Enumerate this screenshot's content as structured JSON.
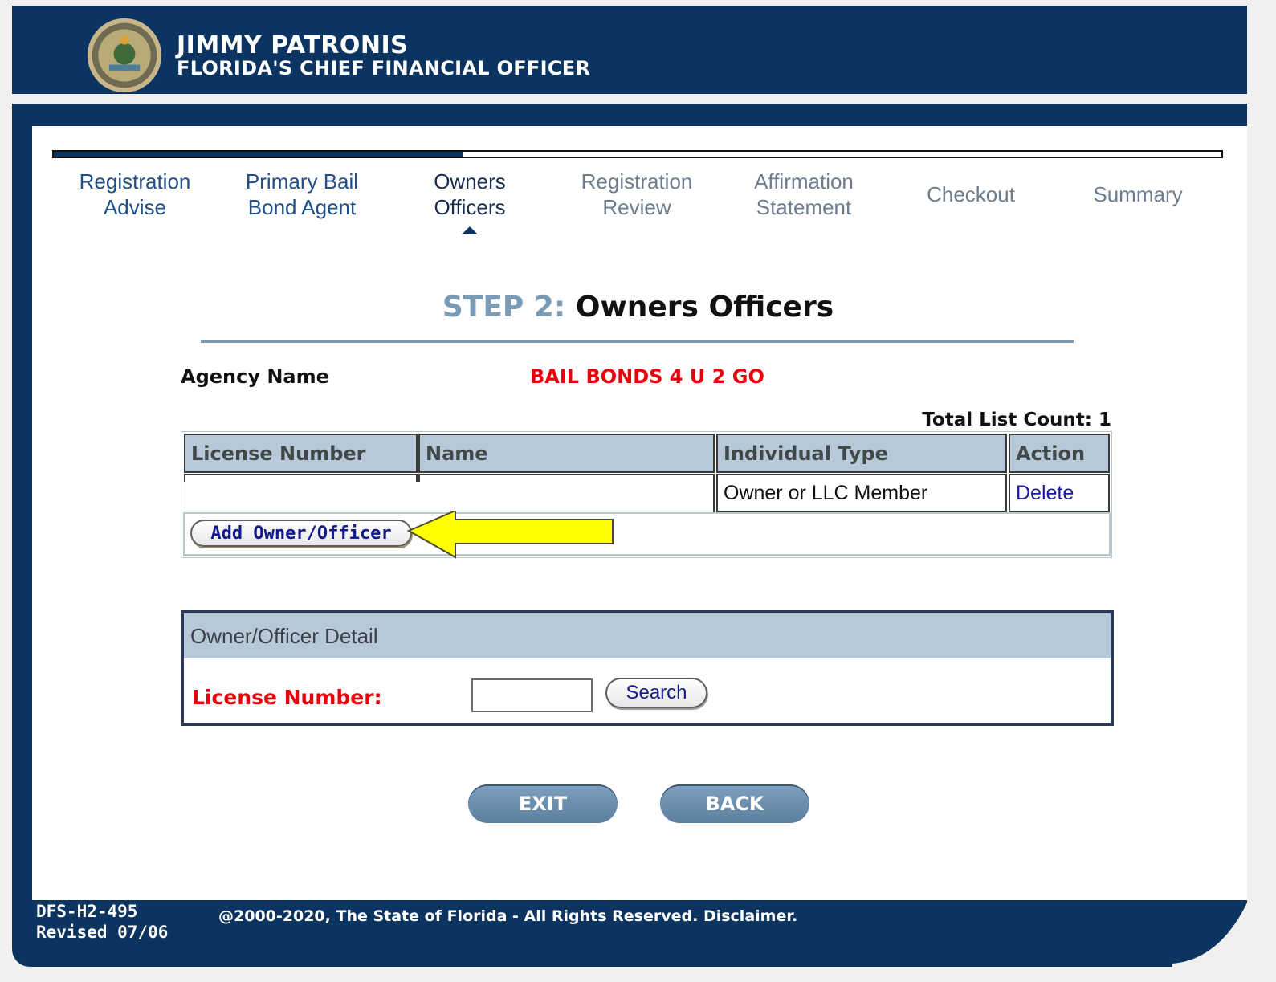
{
  "header": {
    "name": "JIMMY PATRONIS",
    "title": "FLORIDA'S CHIEF FINANCIAL OFFICER",
    "seal_icon": "florida-cfo-seal-icon"
  },
  "progress": {
    "fraction_complete": 0.35
  },
  "steps": [
    {
      "line1": "Registration",
      "line2": "Advise",
      "state": "completed"
    },
    {
      "line1": "Primary Bail",
      "line2": "Bond Agent",
      "state": "completed"
    },
    {
      "line1": "Owners",
      "line2": "Officers",
      "state": "current"
    },
    {
      "line1": "Registration",
      "line2": "Review",
      "state": "future"
    },
    {
      "line1": "Affirmation",
      "line2": "Statement",
      "state": "future"
    },
    {
      "line1": "Checkout",
      "line2": "",
      "state": "future"
    },
    {
      "line1": "Summary",
      "line2": "",
      "state": "future"
    }
  ],
  "page": {
    "step_prefix": "STEP 2:",
    "step_name": "Owners Officers"
  },
  "agency": {
    "label": "Agency Name",
    "value": "BAIL BONDS 4 U 2 GO"
  },
  "list": {
    "count_text": "Total List Count: 1",
    "columns": [
      "License Number",
      "Name",
      "Individual Type",
      "Action"
    ],
    "rows": [
      {
        "license_number": "",
        "name": "",
        "individual_type": "Owner or LLC Member",
        "action": "Delete"
      }
    ],
    "add_button": "Add Owner/Officer"
  },
  "detail": {
    "title": "Owner/Officer Detail",
    "license_label": "License Number:",
    "license_value": "",
    "search_button": "Search"
  },
  "buttons": {
    "exit": "EXIT",
    "back": "BACK"
  },
  "footer": {
    "form_code": "DFS-H2-495",
    "revised": "Revised 07/06",
    "copyright": "@2000-2020, The State of Florida - All Rights Reserved. Disclaimer."
  },
  "colors": {
    "navy": "#0c3460",
    "alert_red": "#e8000b",
    "highlight_arrow": "#ffff00"
  }
}
